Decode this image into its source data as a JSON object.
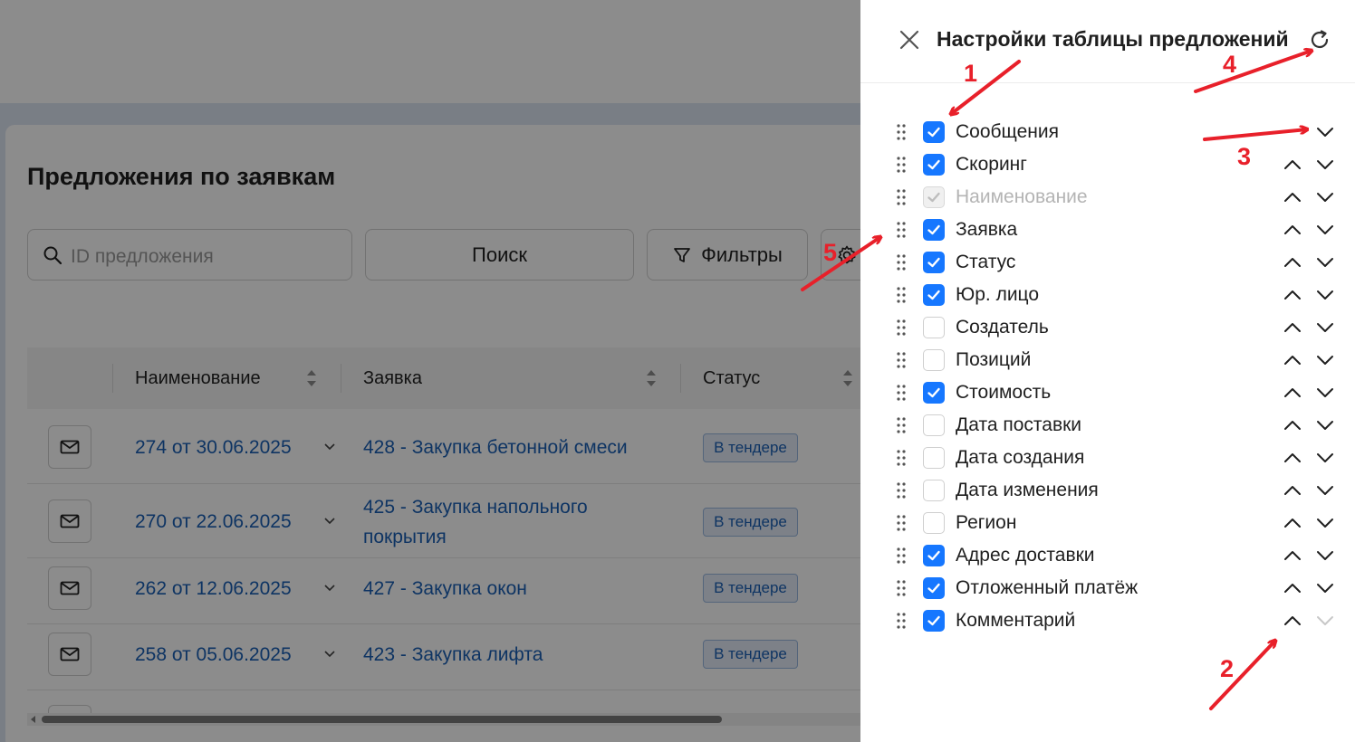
{
  "page": {
    "title": "Предложения по заявкам",
    "search_placeholder": "ID предложения",
    "search_button": "Поиск",
    "filters_button": "Фильтры",
    "columns": [
      "Наименование",
      "Заявка",
      "Статус"
    ],
    "rows": [
      {
        "offer": "274 от 30.06.2025",
        "request_line1": "428 - Закупка бетонной смеси",
        "request_line2": "",
        "status": "В тендере"
      },
      {
        "offer": "270 от 22.06.2025",
        "request_line1": "425 - Закупка напольного",
        "request_line2": "покрытия",
        "status": "В тендере"
      },
      {
        "offer": "262 от 12.06.2025",
        "request_line1": "427 - Закупка окон",
        "request_line2": "",
        "status": "В тендере"
      },
      {
        "offer": "258 от 05.06.2025",
        "request_line1": "423 - Закупка лифта",
        "request_line2": "",
        "status": "В тендере"
      }
    ]
  },
  "drawer": {
    "title": "Настройки таблицы предложений",
    "items": [
      {
        "label": "Сообщения",
        "checked": true,
        "disabled": false
      },
      {
        "label": "Скоринг",
        "checked": true,
        "disabled": false
      },
      {
        "label": "Наименование",
        "checked": true,
        "disabled": true
      },
      {
        "label": "Заявка",
        "checked": true,
        "disabled": false
      },
      {
        "label": "Статус",
        "checked": true,
        "disabled": false
      },
      {
        "label": "Юр. лицо",
        "checked": true,
        "disabled": false
      },
      {
        "label": "Создатель",
        "checked": false,
        "disabled": false
      },
      {
        "label": "Позиций",
        "checked": false,
        "disabled": false
      },
      {
        "label": "Стоимость",
        "checked": true,
        "disabled": false
      },
      {
        "label": "Дата поставки",
        "checked": false,
        "disabled": false
      },
      {
        "label": "Дата создания",
        "checked": false,
        "disabled": false
      },
      {
        "label": "Дата изменения",
        "checked": false,
        "disabled": false
      },
      {
        "label": "Регион",
        "checked": false,
        "disabled": false
      },
      {
        "label": "Адрес доставки",
        "checked": true,
        "disabled": false
      },
      {
        "label": "Отложенный платёж",
        "checked": true,
        "disabled": false
      },
      {
        "label": "Комментарий",
        "checked": true,
        "disabled": false
      }
    ]
  },
  "annotations": [
    "1",
    "2",
    "3",
    "4",
    "5"
  ],
  "colors": {
    "accent": "#1677ff",
    "link": "#1a5fb4",
    "annotation": "#e8202a"
  }
}
